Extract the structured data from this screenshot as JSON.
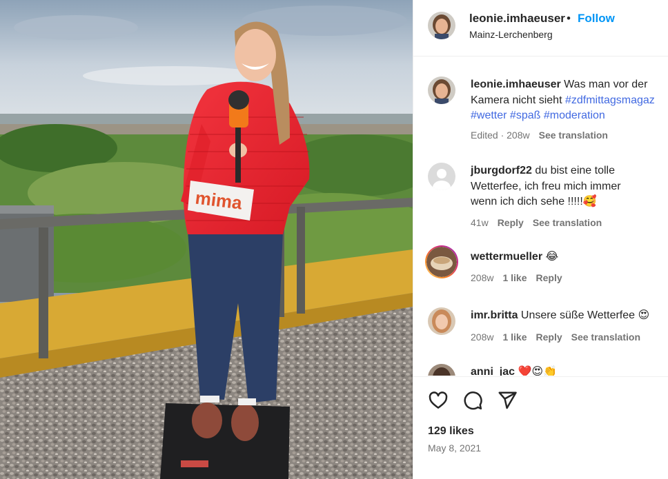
{
  "post": {
    "username": "leonie.imhaeuser",
    "separator": "•",
    "follow_label": "Follow",
    "location": "Mainz-Lerchenberg",
    "caption_text_1": "Was man vor der",
    "caption_text_2": "Kamera nicht sieht ",
    "caption_tags_line2": "#zdfmittagsmagaz",
    "caption_tags_line3_a": "#wetter",
    "caption_tags_line3_b": "#spaß",
    "caption_tags_line3_c": "#moderation",
    "caption_meta_edited": "Edited · 208w",
    "caption_meta_translate": "See translation",
    "likes": "129 likes",
    "date": "May 8, 2021"
  },
  "photo": {
    "mic_label": "mima"
  },
  "comments": [
    {
      "username": "jburgdorf22",
      "text_1": "du bist eine tolle",
      "text_2": "Wetterfee, ich freu mich immer",
      "text_3": "wenn ich dich sehe !!!!!🥰",
      "age": "41w",
      "reply": "Reply",
      "translate": "See translation"
    },
    {
      "username": "wettermueller",
      "text_1": "😂",
      "age": "208w",
      "likes": "1 like",
      "reply": "Reply"
    },
    {
      "username": "imr.britta",
      "text_1": "Unsere süße Wetterfee 😍",
      "age": "208w",
      "likes": "1 like",
      "reply": "Reply",
      "translate": "See translation"
    },
    {
      "username": "anni_jac",
      "text_1": "❤️😍👏"
    }
  ],
  "icons": {
    "like": "heart-icon",
    "comment": "comment-bubble-icon",
    "share": "paper-plane-icon"
  },
  "colors": {
    "follow": "#0095f6",
    "hashtag": "#4169e1",
    "muted": "#737373",
    "jacket": "#e8242f"
  }
}
